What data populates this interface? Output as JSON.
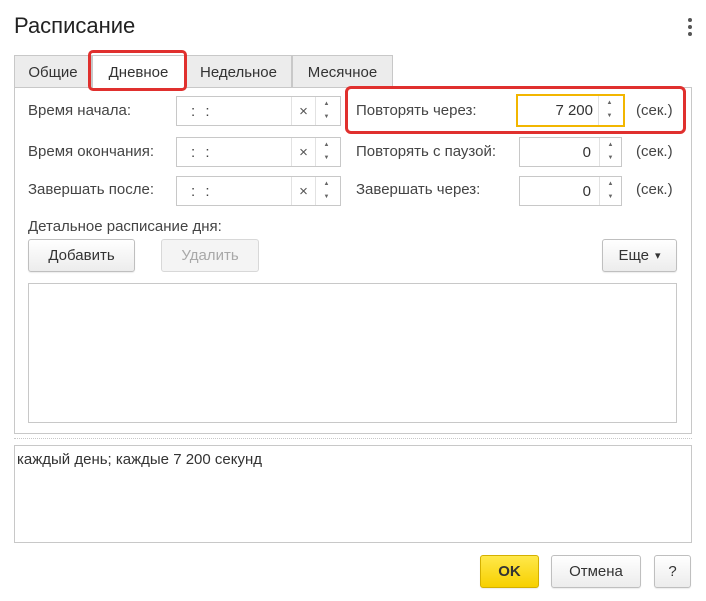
{
  "window": {
    "title": "Расписание"
  },
  "tabs": [
    {
      "label": "Общие"
    },
    {
      "label": "Дневное"
    },
    {
      "label": "Недельное"
    },
    {
      "label": "Месячное"
    }
  ],
  "left_fields": [
    {
      "label": "Время начала:",
      "value": ":  :"
    },
    {
      "label": "Время окончания:",
      "value": ":  :"
    },
    {
      "label": "Завершать после:",
      "value": ":  :"
    }
  ],
  "right_fields": [
    {
      "label": "Повторять через:",
      "value": "7 200",
      "unit": "(сек.)"
    },
    {
      "label": "Повторять с паузой:",
      "value": "0",
      "unit": "(сек.)"
    },
    {
      "label": "Завершать через:",
      "value": "0",
      "unit": "(сек.)"
    }
  ],
  "detail": {
    "label": "Детальное расписание дня:",
    "add_button": "Добавить",
    "delete_button": "Удалить",
    "more_button": "Еще"
  },
  "summary_text": "каждый день; каждые 7 200 секунд",
  "footer": {
    "ok": "OK",
    "cancel": "Отмена",
    "help": "?"
  },
  "icons": {
    "clear": "×",
    "spin_up": "▲",
    "spin_down": "▼",
    "more_caret": "▾"
  },
  "colors": {
    "highlight": "#e0302e",
    "focus": "#f2b600",
    "ok_button": "#f7d000"
  }
}
